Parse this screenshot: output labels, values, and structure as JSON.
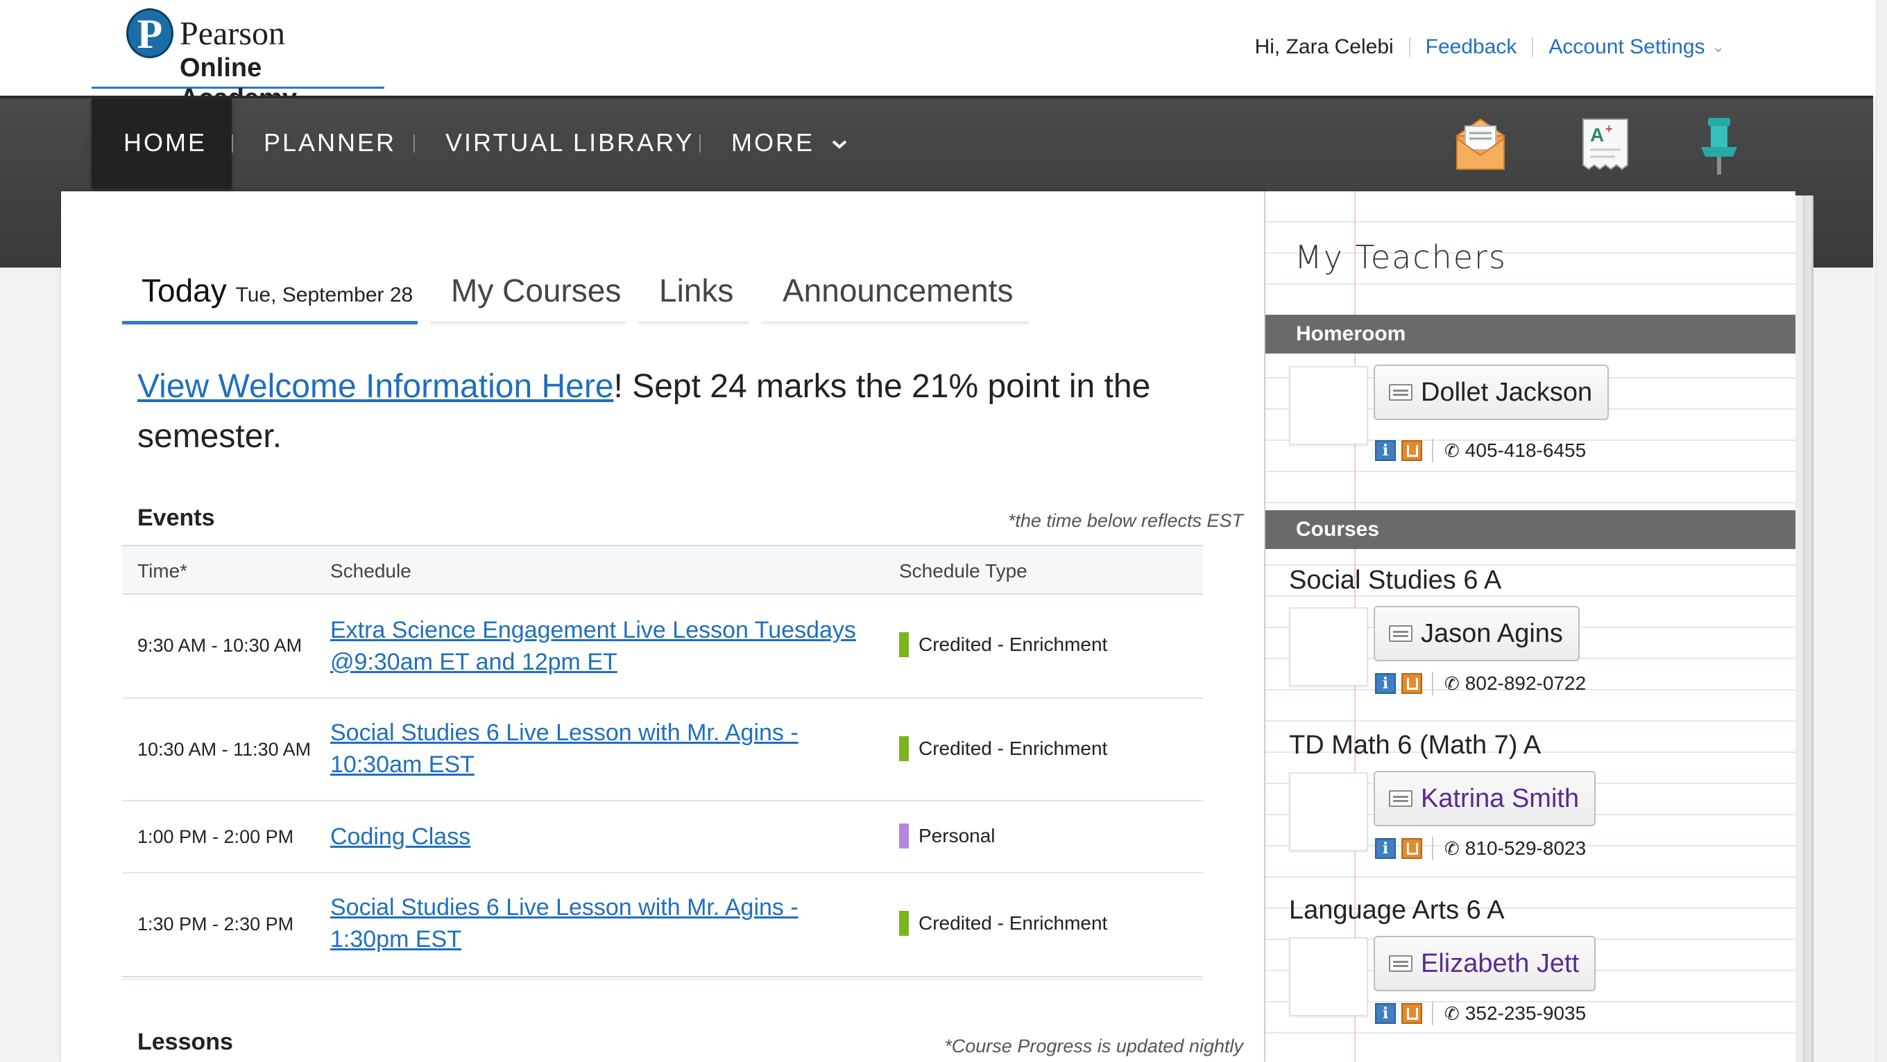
{
  "brand": {
    "line1": "Pearson",
    "line2": "Online Academy",
    "mark": "P"
  },
  "header": {
    "greeting": "Hi, Zara Celebi",
    "feedback": "Feedback",
    "account_settings": "Account Settings",
    "account_icon": "chevron-down-icon"
  },
  "nav": {
    "items": [
      {
        "label": "HOME",
        "active": true
      },
      {
        "label": "PLANNER"
      },
      {
        "label": "VIRTUAL LIBRARY"
      },
      {
        "label": "MORE"
      }
    ],
    "more_icon": "chevron-down-icon",
    "icons": [
      "mail-icon",
      "grades-icon",
      "pin-icon"
    ]
  },
  "tabs": {
    "today": "Today",
    "today_date": "Tue, September 28",
    "my_courses": "My Courses",
    "links": "Links",
    "announcements": "Announcements"
  },
  "welcome": {
    "link": "View Welcome Information Here",
    "text": "! Sept 24 marks the 21% point in the semester."
  },
  "events": {
    "heading": "Events",
    "note": "*the time below reflects EST",
    "columns": {
      "time": "Time*",
      "schedule": "Schedule",
      "type": "Schedule Type"
    },
    "rows": [
      {
        "time": "9:30 AM - 10:30 AM",
        "schedule": "Extra Science Engagement Live Lesson Tuesdays @9:30am ET and 12pm ET",
        "type": "Credited - Enrichment",
        "color": "#7ab51d"
      },
      {
        "time": "10:30 AM - 11:30 AM",
        "schedule": "Social Studies 6 Live Lesson with Mr. Agins - 10:30am EST",
        "type": "Credited - Enrichment",
        "color": "#7ab51d"
      },
      {
        "time": "1:00 PM - 2:00 PM",
        "schedule": "Coding Class",
        "type": "Personal",
        "color": "#b784e0"
      },
      {
        "time": "1:30 PM - 2:30 PM",
        "schedule": "Social Studies 6 Live Lesson with Mr. Agins - 1:30pm EST",
        "type": "Credited - Enrichment",
        "color": "#7ab51d"
      }
    ]
  },
  "lessons": {
    "heading": "Lessons",
    "note": "*Course Progress is updated nightly"
  },
  "teachers": {
    "title": "My Teachers",
    "homeroom_label": "Homeroom",
    "courses_label": "Courses",
    "homeroom": {
      "teacher": "Dollet Jackson",
      "phone": "405-418-6455"
    },
    "courses": [
      {
        "course": "Social Studies 6 A",
        "teacher": "Jason Agins",
        "phone": "802-892-0722"
      },
      {
        "course": "TD Math 6 (Math 7) A",
        "teacher": "Katrina Smith",
        "phone": "810-529-8023"
      },
      {
        "course": "Language Arts 6 A",
        "teacher": "Elizabeth Jett",
        "phone": "352-235-9035"
      }
    ]
  },
  "colors": {
    "accent": "#1f6fbf",
    "nav_bg": "#444444",
    "band": "#6a6a6a"
  }
}
